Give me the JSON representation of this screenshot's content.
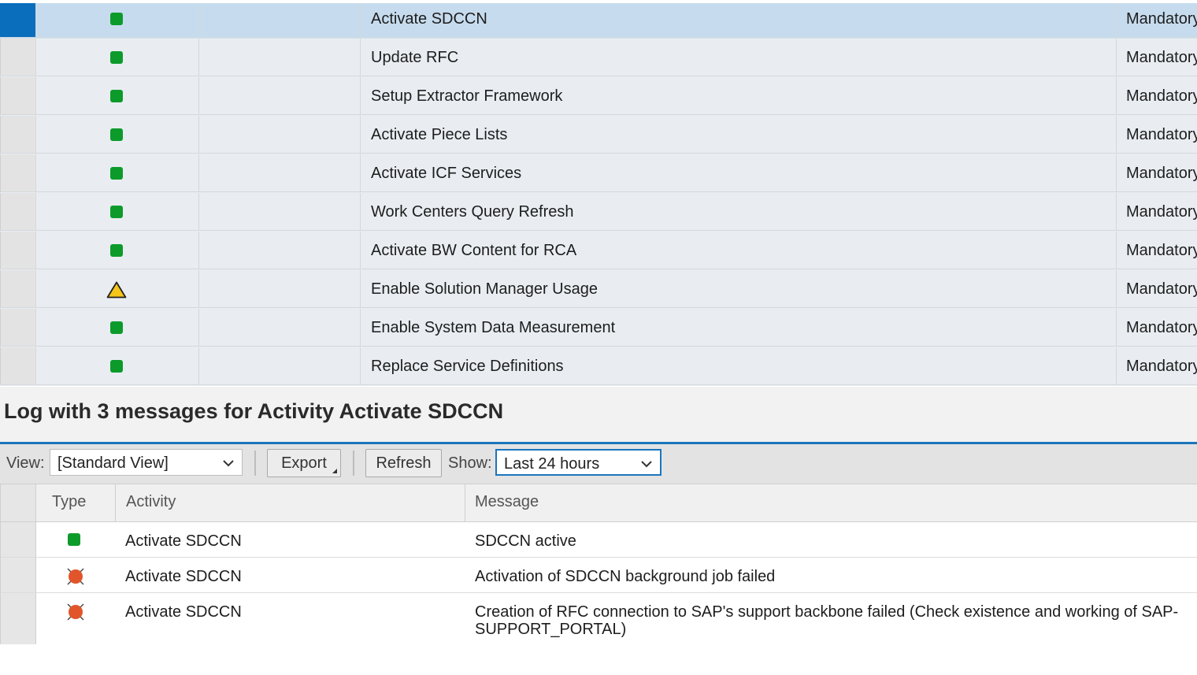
{
  "activities": [
    {
      "status": "success",
      "status_icon": "green-square-icon",
      "name": "Activate SDCCN",
      "type": "Mandatory",
      "selected": true
    },
    {
      "status": "success",
      "status_icon": "green-square-icon",
      "name": "Update RFC",
      "type": "Mandatory"
    },
    {
      "status": "success",
      "status_icon": "green-square-icon",
      "name": "Setup Extractor Framework",
      "type": "Mandatory"
    },
    {
      "status": "success",
      "status_icon": "green-square-icon",
      "name": "Activate Piece Lists",
      "type": "Mandatory"
    },
    {
      "status": "success",
      "status_icon": "green-square-icon",
      "name": "Activate ICF Services",
      "type": "Mandatory"
    },
    {
      "status": "success",
      "status_icon": "green-square-icon",
      "name": "Work Centers Query Refresh",
      "type": "Mandatory"
    },
    {
      "status": "success",
      "status_icon": "green-square-icon",
      "name": "Activate BW Content for RCA",
      "type": "Mandatory"
    },
    {
      "status": "warning",
      "status_icon": "warning-triangle-icon",
      "name": "Enable Solution Manager Usage",
      "type": "Mandatory"
    },
    {
      "status": "success",
      "status_icon": "green-square-icon",
      "name": "Enable System Data Measurement",
      "type": "Mandatory"
    },
    {
      "status": "success",
      "status_icon": "green-square-icon",
      "name": "Replace Service Definitions",
      "type": "Mandatory"
    }
  ],
  "log": {
    "title": "Log with 3 messages for Activity Activate SDCCN",
    "toolbar": {
      "view_label": "View:",
      "view_value": "[Standard View]",
      "export_label": "Export",
      "refresh_label": "Refresh",
      "show_label": "Show:",
      "show_value": "Last 24 hours"
    },
    "columns": {
      "type": "Type",
      "activity": "Activity",
      "message": "Message"
    },
    "rows": [
      {
        "type": "success",
        "type_icon": "green-square-icon",
        "activity": "Activate SDCCN",
        "message": "SDCCN active"
      },
      {
        "type": "error",
        "type_icon": "error-circle-icon",
        "activity": "Activate SDCCN",
        "message": "Activation of SDCCN background job failed"
      },
      {
        "type": "error",
        "type_icon": "error-circle-icon",
        "activity": "Activate SDCCN",
        "message": "Creation of RFC connection to SAP's support backbone failed (Check existence and working of SAP-SUPPORT_PORTAL)"
      }
    ]
  },
  "colors": {
    "success": "#0c9b2b",
    "warning": "#f5c518",
    "error": "#e0562a",
    "accent": "#1b75bb",
    "selection": "#0a6ebd"
  }
}
